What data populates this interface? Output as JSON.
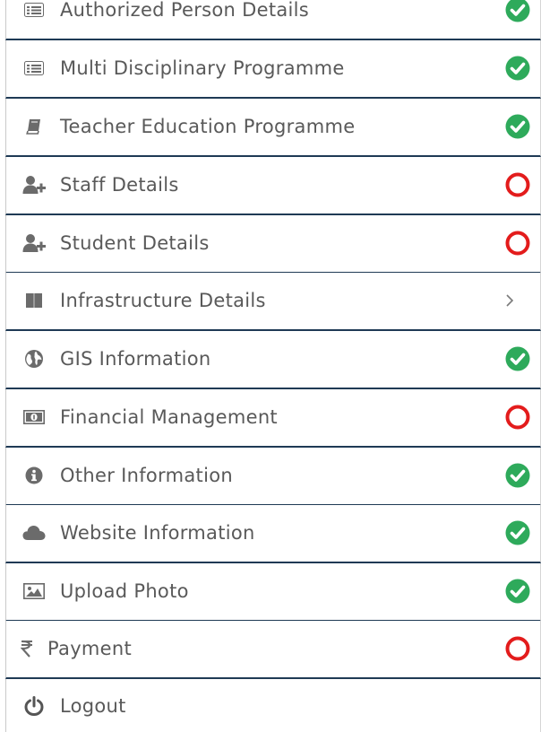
{
  "menu": {
    "items": [
      {
        "label": "Authorized Person Details",
        "status": "complete"
      },
      {
        "label": "Multi Disciplinary Programme",
        "status": "complete"
      },
      {
        "label": "Teacher Education Programme",
        "status": "complete"
      },
      {
        "label": "Staff Details",
        "status": "incomplete"
      },
      {
        "label": "Student Details",
        "status": "incomplete"
      },
      {
        "label": "Infrastructure Details",
        "status": "expand"
      },
      {
        "label": "GIS Information",
        "status": "complete"
      },
      {
        "label": "Financial Management",
        "status": "incomplete"
      },
      {
        "label": "Other Information",
        "status": "complete"
      },
      {
        "label": "Website Information",
        "status": "complete"
      },
      {
        "label": "Upload Photo",
        "status": "complete"
      },
      {
        "label": "Payment",
        "status": "incomplete"
      },
      {
        "label": "Logout",
        "status": "none"
      }
    ]
  },
  "colors": {
    "complete": "#2eaa5b",
    "incomplete": "#e31c1c",
    "divider": "#1f3a55",
    "label": "#595959",
    "icon": "#6b6b6b"
  },
  "icons": [
    "list-icon",
    "list-icon",
    "book-icon",
    "add-user-icon",
    "add-user-icon",
    "building-icon",
    "globe-icon",
    "money-icon",
    "info-icon",
    "cloud-icon",
    "image-icon",
    "rupee-icon",
    "power-icon"
  ]
}
